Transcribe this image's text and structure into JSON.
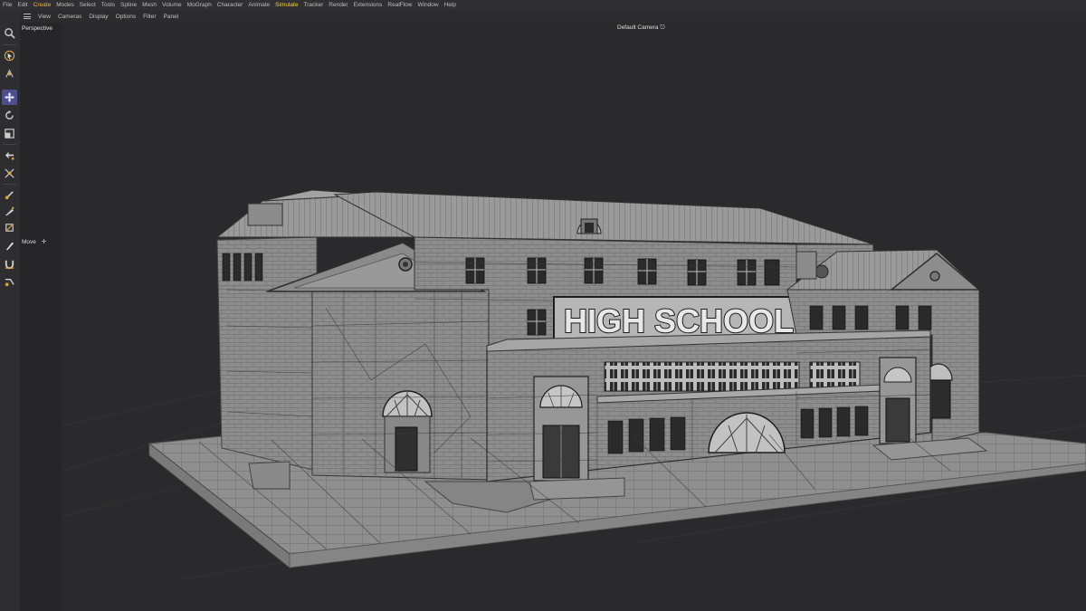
{
  "menu": [
    "File",
    "Edit",
    "Create",
    "Modes",
    "Select",
    "Tools",
    "Spline",
    "Mesh",
    "Volume",
    "MoGraph",
    "Character",
    "Animate",
    "Simulate",
    "Tracker",
    "Render",
    "Extensions",
    "RealFlow",
    "Window",
    "Help"
  ],
  "view_menu": [
    "View",
    "Cameras",
    "Display",
    "Options",
    "Filter",
    "Panel"
  ],
  "viewport": {
    "view_label": "Perspective",
    "camera_label": "Default Camera",
    "camera_icon": "camera-link-icon",
    "tool_label": "Move",
    "tool_label_icon": "move-crosshair-icon"
  },
  "sign_text": "HIGH SCHOOL",
  "tools": [
    "search-icon",
    "live-selection-icon",
    "transform-icon",
    "move-icon",
    "rotate-icon",
    "scale-icon",
    "snap-icon",
    "axis-icon",
    "polygon-pen-icon",
    "knife-icon",
    "bevel-icon",
    "brush-icon",
    "magnet-icon",
    "weld-icon"
  ],
  "colors": {
    "active_tool": "#4d4f8c",
    "create_menu": "#f0b43a",
    "simulate_menu": "#f0d23a",
    "background": "#2a2a2c"
  }
}
